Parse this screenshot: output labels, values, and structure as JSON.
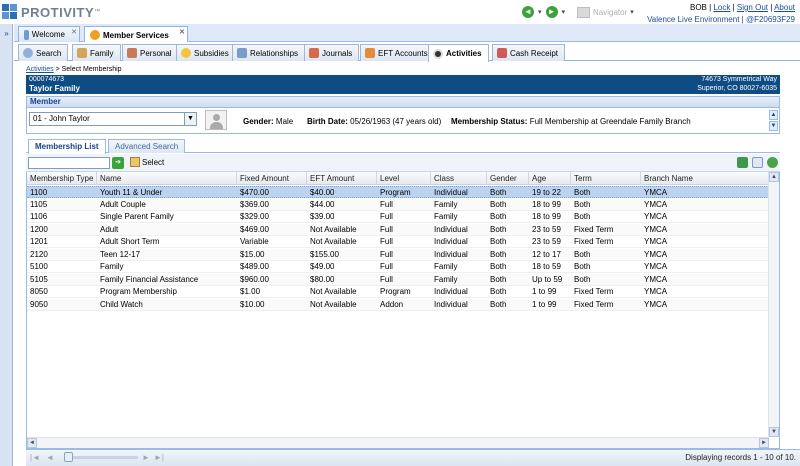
{
  "brand": {
    "name": "PROTIVITY",
    "tm": "™"
  },
  "nav": {
    "back": "◄",
    "forward": "►",
    "navigator_label": "Navigator"
  },
  "user": {
    "name": "BOB",
    "lock": "Lock",
    "sign_out": "Sign Out",
    "about": "About",
    "environment": "Valence Live Environment",
    "build": "@F20693F29"
  },
  "main_tabs": [
    {
      "label": "Welcome",
      "active": false
    },
    {
      "label": "Member Services",
      "active": true
    }
  ],
  "sub_tabs": [
    {
      "label": "Search",
      "icon": "magnifier-icon"
    },
    {
      "label": "Family",
      "icon": "family-icon"
    },
    {
      "label": "Personal",
      "icon": "person-icon"
    },
    {
      "label": "Subsidies",
      "icon": "coin-icon"
    },
    {
      "label": "Relationships",
      "icon": "relationships-icon"
    },
    {
      "label": "Journals",
      "icon": "journal-icon"
    },
    {
      "label": "EFT Accounts",
      "icon": "eft-icon"
    },
    {
      "label": "Activities",
      "icon": "ball-icon",
      "active": true
    },
    {
      "label": "Cash Receipt",
      "icon": "cash-icon"
    }
  ],
  "breadcrumb": {
    "parent": "Activities",
    "sep": ">",
    "current": "Select Membership"
  },
  "account": {
    "number": "000074673",
    "family": "Taylor Family",
    "address1": "74673 Symmetrical Way",
    "address2": "Superior, CO 80027-6035"
  },
  "member": {
    "header": "Member",
    "selected": "01 - John Taylor",
    "gender_label": "Gender:",
    "gender": "Male",
    "birth_label": "Birth Date:",
    "birth": "05/26/1963 (47 years old)",
    "status_label": "Membership Status:",
    "status": "Full Membership at Greendale Family Branch"
  },
  "inner_tabs": [
    {
      "label": "Membership List",
      "active": true
    },
    {
      "label": "Advanced Search",
      "active": false
    }
  ],
  "toolbar": {
    "search_value": "",
    "select_label": "Select"
  },
  "grid": {
    "columns": [
      "Membership Type",
      "Name",
      "Fixed Amount",
      "EFT Amount",
      "Level",
      "Class",
      "Gender",
      "Age",
      "Term",
      "Branch Name"
    ],
    "rows": [
      [
        "1100",
        "Youth 11 & Under",
        "$470.00",
        "$40.00",
        "Program",
        "Individual",
        "Both",
        "19 to 22",
        "Both",
        "YMCA"
      ],
      [
        "1105",
        "Adult Couple",
        "$369.00",
        "$44.00",
        "Full",
        "Family",
        "Both",
        "18 to 99",
        "Both",
        "YMCA"
      ],
      [
        "1106",
        "Single Parent Family",
        "$329.00",
        "$39.00",
        "Full",
        "Family",
        "Both",
        "18 to 99",
        "Both",
        "YMCA"
      ],
      [
        "1200",
        "Adult",
        "$469.00",
        "Not Available",
        "Full",
        "Individual",
        "Both",
        "23 to 59",
        "Fixed Term",
        "YMCA"
      ],
      [
        "1201",
        "Adult Short Term",
        "Variable",
        "Not Available",
        "Full",
        "Individual",
        "Both",
        "23 to 59",
        "Fixed Term",
        "YMCA"
      ],
      [
        "2120",
        "Teen 12-17",
        "$15.00",
        "$155.00",
        "Full",
        "Individual",
        "Both",
        "12 to 17",
        "Both",
        "YMCA"
      ],
      [
        "5100",
        "Family",
        "$489.00",
        "$49.00",
        "Full",
        "Family",
        "Both",
        "18 to 59",
        "Both",
        "YMCA"
      ],
      [
        "5105",
        "Family Financial Assistance",
        "$960.00",
        "$80.00",
        "Full",
        "Family",
        "Both",
        "Up to 59",
        "Both",
        "YMCA"
      ],
      [
        "8050",
        "Program Membership",
        "$1.00",
        "Not Available",
        "Program",
        "Individual",
        "Both",
        "1 to 99",
        "Fixed Term",
        "YMCA"
      ],
      [
        "9050",
        "Child Watch",
        "$10.00",
        "Not Available",
        "Addon",
        "Individual",
        "Both",
        "1 to 99",
        "Fixed Term",
        "YMCA"
      ]
    ],
    "selected_row": 0
  },
  "pager": {
    "info": "Displaying records 1 - 10 of 10."
  },
  "colors": {
    "accent": "#0f4c84",
    "tab_border": "#99bbe8",
    "selected_row": "#bcd3f0",
    "link": "#1a4d9c"
  }
}
